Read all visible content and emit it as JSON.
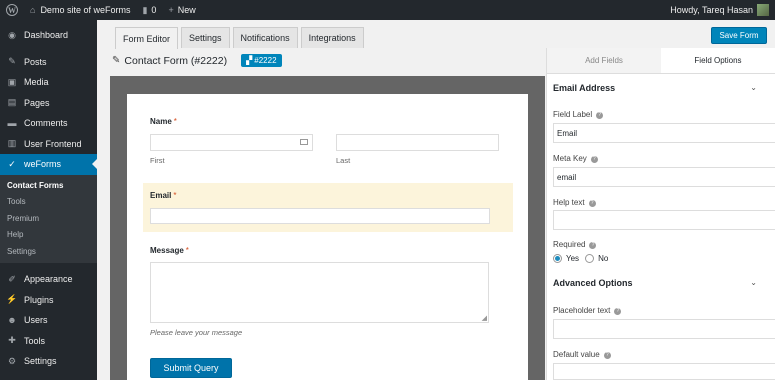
{
  "adminbar": {
    "site_name": "Demo site of weForms",
    "comments_count": "0",
    "new_label": "New",
    "greeting": "Howdy, Tareq Hasan"
  },
  "sidebar": {
    "items_top": [
      {
        "label": "Dashboard",
        "icon": "dashboard-icon",
        "glyph": "◉"
      }
    ],
    "items_mid": [
      {
        "label": "Posts",
        "icon": "pin-icon",
        "glyph": "✎"
      },
      {
        "label": "Media",
        "icon": "media-icon",
        "glyph": "▣"
      },
      {
        "label": "Pages",
        "icon": "page-icon",
        "glyph": "▤"
      },
      {
        "label": "Comments",
        "icon": "comment-icon",
        "glyph": "▬"
      },
      {
        "label": "User Frontend",
        "icon": "frontend-icon",
        "glyph": "▥"
      }
    ],
    "active_item": {
      "label": "weForms",
      "icon": "weforms-icon",
      "glyph": "✓"
    },
    "submenu": [
      "Contact Forms",
      "Tools",
      "Premium",
      "Help",
      "Settings"
    ],
    "items_bottom": [
      {
        "label": "Appearance",
        "icon": "brush-icon",
        "glyph": "✐"
      },
      {
        "label": "Plugins",
        "icon": "plugin-icon",
        "glyph": "⚡"
      },
      {
        "label": "Users",
        "icon": "users-icon",
        "glyph": "☻"
      },
      {
        "label": "Tools",
        "icon": "wrench-icon",
        "glyph": "✚"
      },
      {
        "label": "Settings",
        "icon": "settings-icon",
        "glyph": "⚙"
      }
    ]
  },
  "tabs": [
    "Form Editor",
    "Settings",
    "Notifications",
    "Integrations"
  ],
  "save_label": "Save Form",
  "form_title": "Contact Form (#2222)",
  "shortcode": "#2222",
  "form": {
    "name_label": "Name",
    "first_sub": "First",
    "last_sub": "Last",
    "email_label": "Email",
    "message_label": "Message",
    "message_help": "Please leave your message",
    "submit_label": "Submit Query",
    "required_mark": "*"
  },
  "panel": {
    "tab_add": "Add Fields",
    "tab_options": "Field Options",
    "section_title": "Email Address",
    "field_label_label": "Field Label",
    "field_label_value": "Email",
    "meta_key_label": "Meta Key",
    "meta_key_value": "email",
    "help_text_label": "Help text",
    "required_label": "Required",
    "yes_label": "Yes",
    "no_label": "No",
    "advanced_title": "Advanced Options",
    "placeholder_label": "Placeholder text",
    "default_label": "Default value"
  }
}
